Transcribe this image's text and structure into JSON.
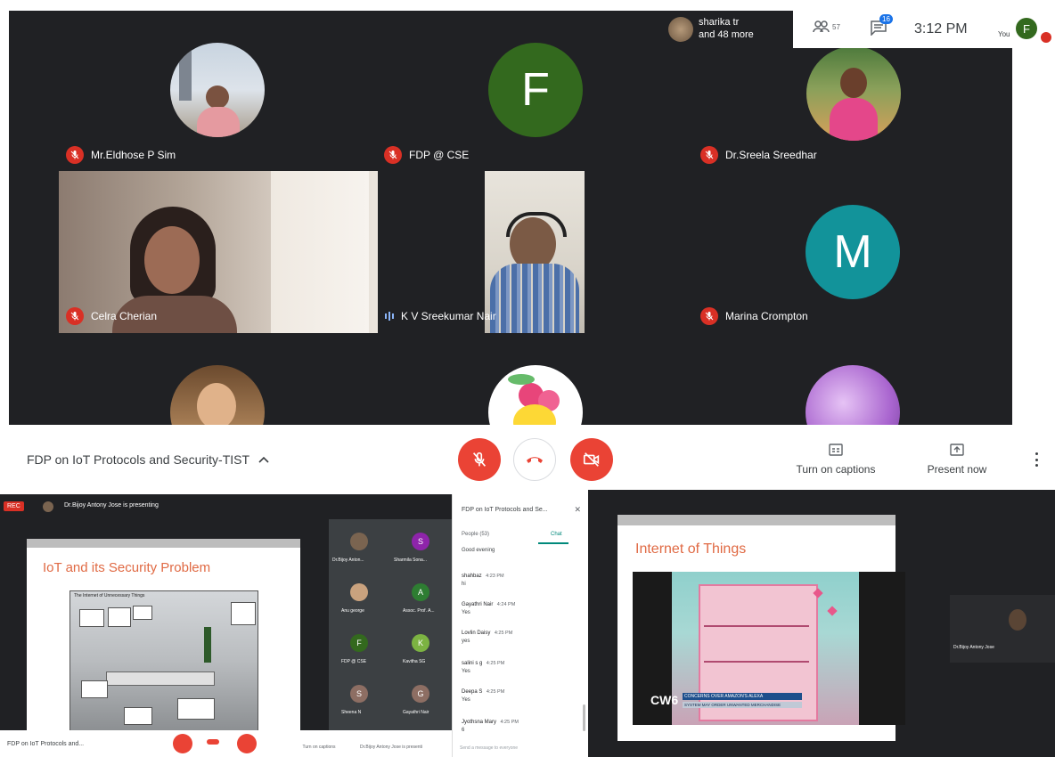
{
  "top_meeting": {
    "participants": [
      {
        "name": "Mr.Eldhose P Sim",
        "muted": true
      },
      {
        "name": "FDP @ CSE",
        "muted": true,
        "initial": "F"
      },
      {
        "name": "Dr.Sreela Sreedhar",
        "muted": true
      },
      {
        "name": "Celra Cherian",
        "muted": true
      },
      {
        "name": "K V Sreekumar Nair",
        "muted": false,
        "speaking": true
      },
      {
        "name": "Marina Crompton",
        "muted": true,
        "initial": "M"
      }
    ],
    "others_indicator": {
      "first_name": "sharika tr",
      "more_text": "and 48 more"
    },
    "people_count": "57",
    "chat_badge": "16",
    "clock": "3:12 PM",
    "self_initial": "F",
    "self_label": "You",
    "meeting_title": "FDP on IoT Protocols and Security-TIST",
    "captions_label": "Turn on captions",
    "present_label": "Present now",
    "colors": {
      "green_avatar": "#33691e",
      "teal_avatar": "#12939a",
      "red": "#ea4335",
      "dark_bg": "#202124"
    }
  },
  "bottom_left": {
    "rec_label": "REC",
    "presenting_text": "Dr.Bijoy Antony Jose is presenting",
    "slide_title": "IoT and its Security Problem",
    "slide_caption": "The Internet of Unnecessary Things",
    "side_participants": [
      {
        "name": "Dr.Bijoy Anton...",
        "initial": ""
      },
      {
        "name": "Sharmila Sona...",
        "initial": "S"
      },
      {
        "name": "Anu george",
        "initial": ""
      },
      {
        "name": "Assoc. Prof. A...",
        "initial": "A"
      },
      {
        "name": "FDP @ CSE",
        "initial": "F"
      },
      {
        "name": "Kavitha SG",
        "initial": "K"
      },
      {
        "name": "Sheena N",
        "initial": "S"
      },
      {
        "name": "Gayathri Nair",
        "initial": "G"
      }
    ],
    "meeting_title": "FDP on IoT Protocols and...",
    "captions_label": "Turn on captions",
    "present_label": "Dr.Bijoy Antony Jose is presenting"
  },
  "chat": {
    "title": "FDP on IoT Protocols and Se...",
    "tab_people": "People (53)",
    "tab_chat": "Chat",
    "messages": [
      {
        "name": "",
        "time": "",
        "text": "Good evening"
      },
      {
        "name": "shahbaz",
        "time": "4:23 PM",
        "text": "hi"
      },
      {
        "name": "Gayathri Nair",
        "time": "4:24 PM",
        "text": "Yes"
      },
      {
        "name": "Lovlin Daisy",
        "time": "4:25 PM",
        "text": "yes"
      },
      {
        "name": "salini s g",
        "time": "4:25 PM",
        "text": "Yes"
      },
      {
        "name": "Deepa S",
        "time": "4:25 PM",
        "text": "Yes"
      },
      {
        "name": "Jyothsna Mary",
        "time": "4:25 PM",
        "text": "6"
      }
    ],
    "input_placeholder": "Send a message to everyone"
  },
  "bottom_right": {
    "slide_title": "Internet of Things",
    "video_logo": "CW6",
    "video_headline": "CONCERNS OVER AMAZON'S ALEXA",
    "video_subheadline": "SYSTEM MAY ORDER UNWANTED MERCHANDISE",
    "presenter_name": "Dr.Bijoy Antony Jose"
  }
}
